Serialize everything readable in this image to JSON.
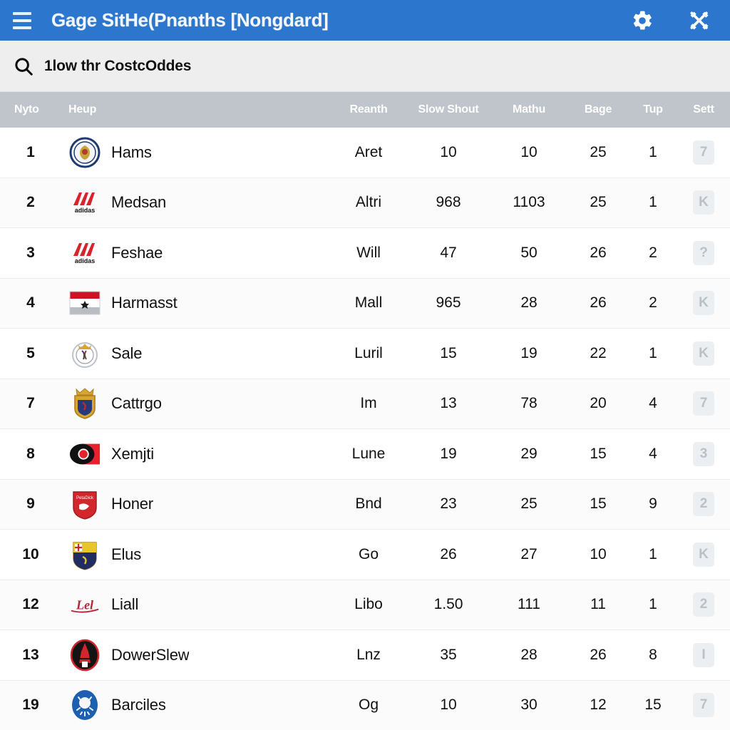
{
  "appbar": {
    "menu_icon": "hamburger-menu-icon",
    "title": "Gage SitHe(Pnanths [Nongdard]",
    "actions": [
      {
        "icon": "gear-icon",
        "name": "settings-button"
      },
      {
        "icon": "crossed-tools-icon",
        "name": "tools-button"
      }
    ],
    "background": "#2d76ce"
  },
  "search": {
    "icon": "search-icon",
    "value": "1low thr CostcOddes",
    "placeholder": "1low thr CostcOddes"
  },
  "table": {
    "columns": [
      {
        "key": "rank",
        "label": "Nyto"
      },
      {
        "key": "team",
        "label": "Heup"
      },
      {
        "key": "reanth",
        "label": "Reanth"
      },
      {
        "key": "slow",
        "label": "Slow Shout"
      },
      {
        "key": "mathu",
        "label": "Mathu"
      },
      {
        "key": "bage",
        "label": "Bage"
      },
      {
        "key": "tup",
        "label": "Tup"
      },
      {
        "key": "sett",
        "label": "Sett"
      }
    ],
    "header_bg": "#bfc5cb",
    "rows": [
      {
        "rank": "1",
        "crest": "crest-navy-circle",
        "team": "Hams",
        "reanth": "Aret",
        "slow": "10",
        "mathu": "10",
        "bage": "25",
        "tup": "1",
        "sett": "7"
      },
      {
        "rank": "2",
        "crest": "crest-red-stripes",
        "team": "Medsan",
        "reanth": "Altri",
        "slow": "968",
        "mathu": "1103",
        "bage": "25",
        "tup": "1",
        "sett": "K"
      },
      {
        "rank": "3",
        "crest": "crest-red-stripes",
        "team": "Feshae",
        "reanth": "Will",
        "slow": "47",
        "mathu": "50",
        "bage": "26",
        "tup": "2",
        "sett": "?"
      },
      {
        "rank": "4",
        "crest": "crest-flag-red-white",
        "team": "Harmasst",
        "reanth": "Mall",
        "slow": "965",
        "mathu": "28",
        "bage": "26",
        "tup": "2",
        "sett": "K"
      },
      {
        "rank": "5",
        "crest": "crest-crown-circle",
        "team": "Sale",
        "reanth": "Luril",
        "slow": "15",
        "mathu": "19",
        "bage": "22",
        "tup": "1",
        "sett": "K"
      },
      {
        "rank": "7",
        "crest": "crest-crown-shield",
        "team": "Cattrgo",
        "reanth": "Im",
        "slow": "13",
        "mathu": "78",
        "bage": "20",
        "tup": "4",
        "sett": "7"
      },
      {
        "rank": "8",
        "crest": "crest-black-red-dot",
        "team": "Xemjti",
        "reanth": "Lune",
        "slow": "19",
        "mathu": "29",
        "bage": "15",
        "tup": "4",
        "sett": "3"
      },
      {
        "rank": "9",
        "crest": "crest-red-shield",
        "team": "Honer",
        "reanth": "Bnd",
        "slow": "23",
        "mathu": "25",
        "bage": "15",
        "tup": "9",
        "sett": "2"
      },
      {
        "rank": "10",
        "crest": "crest-yellow-shield",
        "team": "Elus",
        "reanth": "Go",
        "slow": "26",
        "mathu": "27",
        "bage": "10",
        "tup": "1",
        "sett": "K"
      },
      {
        "rank": "12",
        "crest": "crest-script-red",
        "team": "Liall",
        "reanth": "Libo",
        "slow": "1.50",
        "mathu": "111",
        "bage": "11",
        "tup": "1",
        "sett": "2"
      },
      {
        "rank": "13",
        "crest": "crest-tower-circle",
        "team": "DowerSlew",
        "reanth": "Lnz",
        "slow": "35",
        "mathu": "28",
        "bage": "26",
        "tup": "8",
        "sett": "I"
      },
      {
        "rank": "19",
        "crest": "crest-blue-circle",
        "team": "Barciles",
        "reanth": "Og",
        "slow": "10",
        "mathu": "30",
        "bage": "12",
        "tup": "15",
        "sett": "7"
      }
    ]
  }
}
